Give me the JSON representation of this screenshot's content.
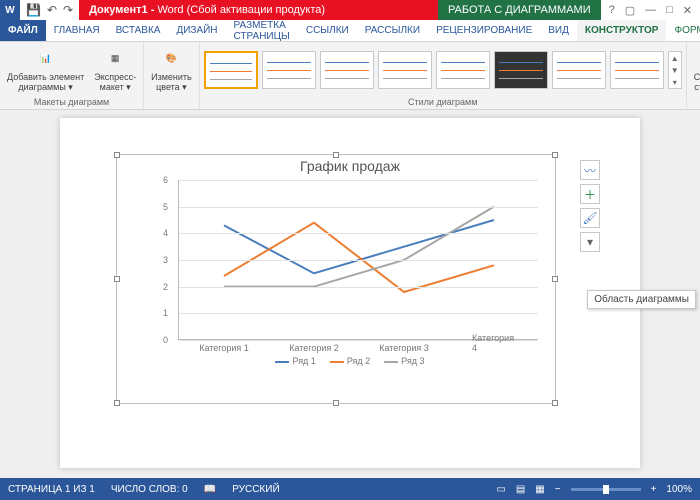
{
  "titlebar": {
    "doc": "Документ1 - ",
    "app": "Word",
    "warn": "(Сбой активации продукта)",
    "context": "РАБОТА С ДИАГРАММАМИ"
  },
  "tabs": {
    "file": "ФАЙЛ",
    "home": "ГЛАВНАЯ",
    "insert": "ВСТАВКА",
    "design": "ДИЗАЙН",
    "layout": "РАЗМЕТКА СТРАНИЦЫ",
    "refs": "ССЫЛКИ",
    "mail": "РАССЫЛКИ",
    "review": "РЕЦЕНЗИРОВАНИЕ",
    "view": "ВИД",
    "ctor": "КОНСТРУКТОР",
    "format": "ФОРМАТ"
  },
  "ribbon": {
    "add_element": "Добавить элемент\nдиаграммы ▾",
    "quick_layout": "Экспресс-\nмакет ▾",
    "layouts_label": "Макеты диаграмм",
    "change_colors": "Изменить\nцвета ▾",
    "styles_label": "Стили диаграмм",
    "row_col": "Строка\nстолбе"
  },
  "chart_data": {
    "type": "line",
    "title": "График продаж",
    "categories": [
      "Категория 1",
      "Категория 2",
      "Категория 3",
      "Категория 4"
    ],
    "series": [
      {
        "name": "Ряд 1",
        "color": "#4a7ebb",
        "values": [
          4.3,
          2.5,
          3.5,
          4.5
        ]
      },
      {
        "name": "Ряд 2",
        "color": "#ed7d31",
        "values": [
          2.4,
          4.4,
          1.8,
          2.8
        ]
      },
      {
        "name": "Ряд 3",
        "color": "#a6a6a6",
        "values": [
          2.0,
          2.0,
          3.0,
          5.0
        ]
      }
    ],
    "ylim": [
      0,
      6
    ],
    "yticks": [
      0,
      1,
      2,
      3,
      4,
      5,
      6
    ]
  },
  "tooltip": "Область диаграммы",
  "status": {
    "page": "СТРАНИЦА 1 ИЗ 1",
    "words": "ЧИСЛО СЛОВ: 0",
    "lang": "РУССКИЙ",
    "zoom": "100%"
  }
}
